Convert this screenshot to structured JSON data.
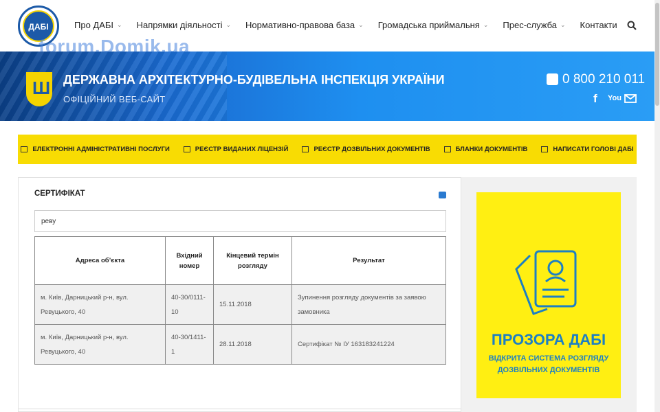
{
  "nav": {
    "items": [
      {
        "label": "Про ДАБІ",
        "chevron": true
      },
      {
        "label": "Напрямки діяльності",
        "chevron": true
      },
      {
        "label": "Нормативно-правова база",
        "chevron": true
      },
      {
        "label": "Громадська приймальня",
        "chevron": true
      },
      {
        "label": "Прес-служба",
        "chevron": true
      },
      {
        "label": "Контакти",
        "chevron": false
      }
    ],
    "logo_text": "ДАБІ",
    "watermark": "forum.Domik.ua"
  },
  "banner": {
    "title": "ДЕРЖАВНА АРХІТЕКТУРНО-БУДІВЕЛЬНА ІНСПЕКЦІЯ УКРАЇНИ",
    "subtitle": "ОФІЦІЙНИЙ ВЕБ-САЙТ",
    "phone": "0 800 210 011",
    "social": [
      "facebook-icon",
      "youtube-icon",
      "mail-icon"
    ]
  },
  "services": [
    {
      "label": "ЕЛЕКТРОННІ АДМІНІСТРАТИВНІ ПОСЛУГИ",
      "icon": "monitor-icon"
    },
    {
      "label": "РЕЄСТР ВИДАНИХ ЛІЦЕНЗІЙ",
      "icon": "list-icon"
    },
    {
      "label": "РЕЄСТР ДОЗВІЛЬНИХ ДОКУМЕНТІВ",
      "icon": "card-icon"
    },
    {
      "label": "БЛАНКИ ДОКУМЕНТІВ",
      "icon": "documents-icon"
    },
    {
      "label": "НАПИСАТИ ГОЛОВІ ДАБІ",
      "icon": "envelope-icon"
    }
  ],
  "main": {
    "title": "СЕРТИФІКАТ",
    "search_value": "реву",
    "table": {
      "headers": [
        "Адреса об’єкта",
        "Вхідний номер",
        "Кінцевий термін розгляду",
        "Результат"
      ],
      "rows": [
        [
          "м. Київ, Дарницький р-н, вул. Ревуцького, 40",
          "40-30/0111-10",
          "15.11.2018",
          "Зупинення розгляду документів за заявою замовника"
        ],
        [
          "м. Київ, Дарницький р-н, вул. Ревуцького, 40",
          "40-30/1411-1",
          "28.11.2018",
          "Сертифікат № ІУ 163183241224"
        ]
      ]
    }
  },
  "side_ad": {
    "title": "ПРОЗОРА ДАБІ",
    "subtitle_line1": "ВІДКРИТА СИСТЕМА РОЗГЛЯДУ",
    "subtitle_line2": "ДОЗВІЛЬНИХ ДОКУМЕНТІВ"
  },
  "colors": {
    "accent_yellow": "#f8dc03",
    "brand_blue": "#1c7fc4",
    "banner_blue": "#1a6ad0"
  }
}
